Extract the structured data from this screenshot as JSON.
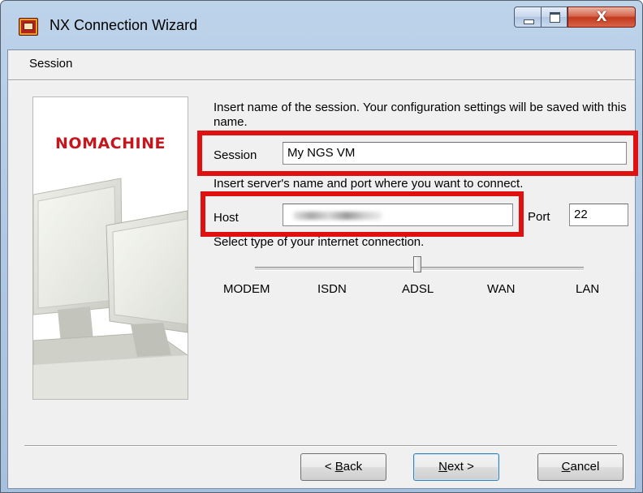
{
  "window": {
    "title": "NX Connection Wizard",
    "close_glyph": "X",
    "icons": [
      "nx-app-icon",
      "minimize-icon",
      "maximize-icon",
      "close-icon"
    ]
  },
  "header": {
    "section_label": "Session"
  },
  "sidebar": {
    "brand_text": "NOMACHINE"
  },
  "session": {
    "instruction": "Insert name of the session. Your configuration settings will be saved with this name.",
    "label": "Session",
    "value": "My NGS VM"
  },
  "server": {
    "instruction": "Insert server's name and port where you want to connect.",
    "host_label": "Host",
    "host_value": "",
    "port_label": "Port",
    "port_value": "22"
  },
  "connection": {
    "instruction": "Select type of your internet connection.",
    "options": [
      "MODEM",
      "ISDN",
      "ADSL",
      "WAN",
      "LAN"
    ],
    "selected": "ADSL",
    "selected_index": 2
  },
  "buttons": {
    "back": {
      "accel": "B",
      "rest": "ack",
      "prefix": "< "
    },
    "next": {
      "accel": "N",
      "rest": "ext >"
    },
    "cancel": {
      "accel": "C",
      "rest": "ancel"
    }
  },
  "highlight_color": "#e01010",
  "brand_color": "#c4161c"
}
